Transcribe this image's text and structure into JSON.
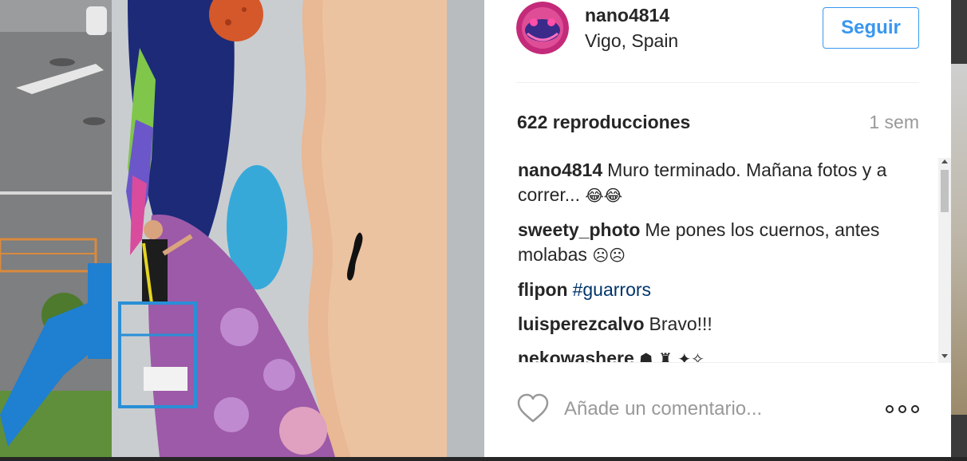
{
  "post": {
    "username": "nano4814",
    "location": "Vigo, Spain",
    "follow_label": "Seguir",
    "views": "622 reproducciones",
    "time_ago": "1 sem"
  },
  "comments": [
    {
      "author": "nano4814",
      "text": "Muro terminado. Mañana fotos y a correr... ",
      "emoji": "😂😂"
    },
    {
      "author": "sweety_photo",
      "text": "Me pones los cuernos, antes molabas ",
      "emoji": "☹☹"
    },
    {
      "author": "flipon",
      "tag": "#guarrors"
    },
    {
      "author": "luisperezcalvo",
      "text": "Bravo!!!"
    },
    {
      "author": "nekowashere",
      "emoji": "☗ ♜ ✦✧"
    }
  ],
  "actions": {
    "comment_placeholder": "Añade un comentario...",
    "like_icon": "heart-outline-icon",
    "more_icon": "more-options-icon"
  },
  "colors": {
    "accent": "#3897f0",
    "hashtag": "#003569",
    "secondary_text": "#999999"
  }
}
